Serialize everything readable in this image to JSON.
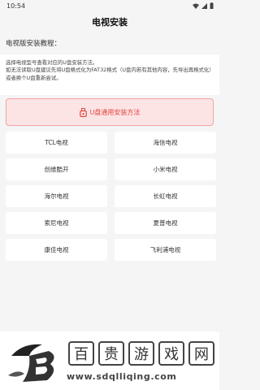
{
  "status_bar": {
    "time": "10:54"
  },
  "header": {
    "title": "电视安装"
  },
  "section": {
    "title": "电视版安装教程："
  },
  "notice": {
    "line1": "选择电视型号查看对应的U盘安装方法。",
    "line2": "如无法读取U盘建议先将U盘格式化为FAT32格式（U盘内若有其他内容，先导出再格式化）或者换个U盘重新尝试。"
  },
  "usb_button": {
    "label": "U盘通用安装方法"
  },
  "brands": [
    {
      "label": "TCL电视"
    },
    {
      "label": "海信电视"
    },
    {
      "label": "创维酷开"
    },
    {
      "label": "小米电视"
    },
    {
      "label": "海尔电视"
    },
    {
      "label": "长虹电视"
    },
    {
      "label": "索尼电视"
    },
    {
      "label": "夏普电视"
    },
    {
      "label": "康佳电视"
    },
    {
      "label": "飞利浦电视"
    }
  ],
  "watermark": {
    "name_chars": [
      "百",
      "贵",
      "游",
      "戏",
      "网"
    ],
    "url": "www.sdqlliqing.com"
  },
  "colors": {
    "accent": "#e0443f",
    "accent_bg": "#fde4e4",
    "page_bg": "#f5f5f5",
    "card_bg": "#ffffff"
  }
}
